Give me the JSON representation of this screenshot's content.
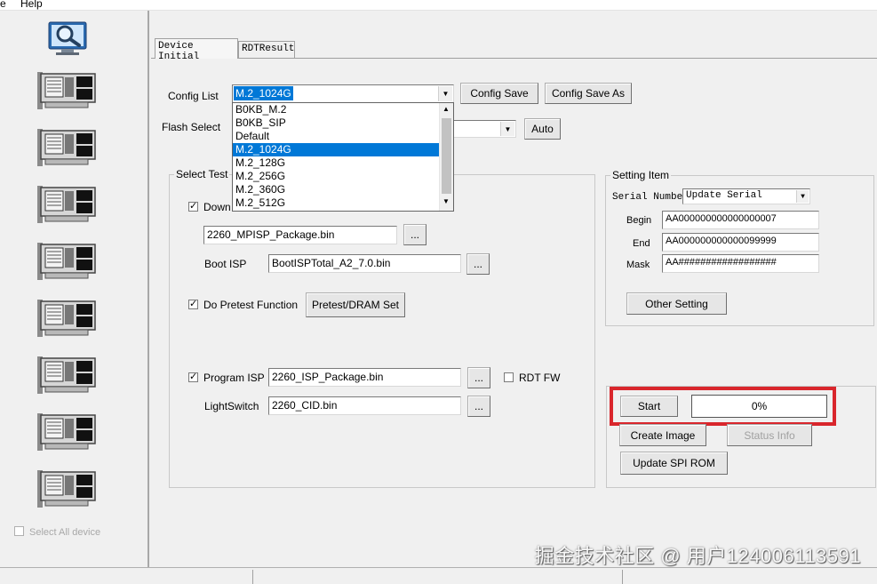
{
  "menu": {
    "file_partial": "e",
    "help": "Help"
  },
  "icons": {
    "magnifier": "magnifier-icon",
    "device_card": "pcb-card-icon",
    "device_count": 8
  },
  "left": {
    "select_all_label": "Select All device",
    "select_all_checked": false
  },
  "tabs": [
    {
      "label": "Device Initial",
      "active": true
    },
    {
      "label": "RDTResult",
      "active": false
    }
  ],
  "config": {
    "list_label": "Config List",
    "list_value": "M.2_1024G",
    "save_label": "Config Save",
    "save_as_label": "Config Save As",
    "flash_select_label": "Flash Select",
    "auto_label": "Auto",
    "dropdown_options": [
      "B0KB_M.2",
      "B0KB_SIP",
      "Default",
      "M.2_1024G",
      "M.2_128G",
      "M.2_256G",
      "M.2_360G",
      "M.2_512G"
    ],
    "dropdown_selected": "M.2_1024G"
  },
  "select_test": {
    "group_title": "Select Test",
    "download_label_partial": "Down",
    "download_checked": true,
    "mpisp_package": "2260_MPISP_Package.bin",
    "boot_isp_label": "Boot ISP",
    "boot_isp_value": "BootISPTotal_A2_7.0.bin",
    "pretest_label": "Do Pretest Function",
    "pretest_checked": true,
    "pretest_button": "Pretest/DRAM Set",
    "program_isp_label": "Program ISP",
    "program_isp_checked": true,
    "program_isp_value": "2260_ISP_Package.bin",
    "rdt_fw_label": "RDT FW",
    "rdt_fw_checked": false,
    "lightswitch_label": "LightSwitch",
    "lightswitch_value": "2260_CID.bin",
    "browse": "..."
  },
  "setting_item": {
    "group_title": "Setting Item",
    "serial_number_label": "Serial Number",
    "serial_mode": "Update Serial",
    "begin_label": "Begin",
    "begin_value": "AA000000000000000007",
    "end_label": "End",
    "end_value": "AA000000000000099999",
    "mask_label": "Mask",
    "mask_value": "AA##################",
    "other_setting": "Other Setting"
  },
  "actions": {
    "start": "Start",
    "progress_text": "0%",
    "progress_value": 0,
    "create_image": "Create Image",
    "status_info": "Status Info",
    "update_spi_rom": "Update SPI ROM"
  },
  "watermark": "掘金技术社区 @ 用户124006113591",
  "colors": {
    "highlight": "#d9262c",
    "selection": "#0078d7"
  }
}
